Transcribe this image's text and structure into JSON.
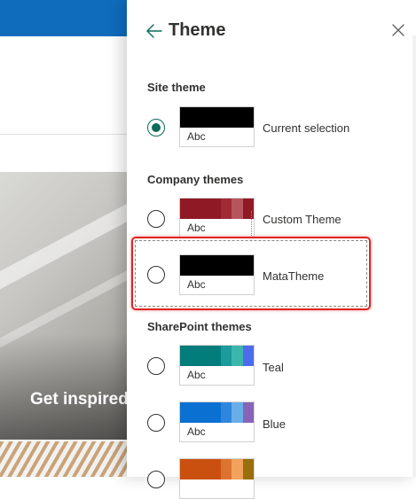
{
  "background": {
    "hero_text": "Get inspired"
  },
  "panel": {
    "title": "Theme",
    "sections": {
      "site": {
        "title": "Site theme",
        "items": [
          {
            "name": "Current selection",
            "abc": "Abc",
            "selected": true,
            "colors": [
              "#000000"
            ]
          }
        ]
      },
      "company": {
        "title": "Company themes",
        "items": [
          {
            "name": "Custom Theme",
            "abc": "Abc",
            "selected": false,
            "colors": [
              "#8f1a26",
              "#8f1a26",
              "#9e2b36",
              "#b6555d",
              "#8f1a26"
            ]
          },
          {
            "name": "MataTheme",
            "abc": "Abc",
            "selected": false,
            "colors": [
              "#000000"
            ]
          }
        ]
      },
      "sharepoint": {
        "title": "SharePoint themes",
        "items": [
          {
            "name": "Teal",
            "abc": "Abc",
            "selected": false,
            "colors": [
              "#037c7c",
              "#037c7c",
              "#1b9b9b",
              "#3cb6ad",
              "#4f6bed"
            ]
          },
          {
            "name": "Blue",
            "abc": "Abc",
            "selected": false,
            "colors": [
              "#0a70d1",
              "#0a70d1",
              "#2f86dc",
              "#6aaee8",
              "#8764b8"
            ]
          },
          {
            "name": "",
            "abc": "",
            "selected": false,
            "colors": [
              "#ca5010",
              "#ca5010",
              "#dc7430",
              "#f2a25c",
              "#986f0b"
            ]
          }
        ]
      }
    }
  }
}
